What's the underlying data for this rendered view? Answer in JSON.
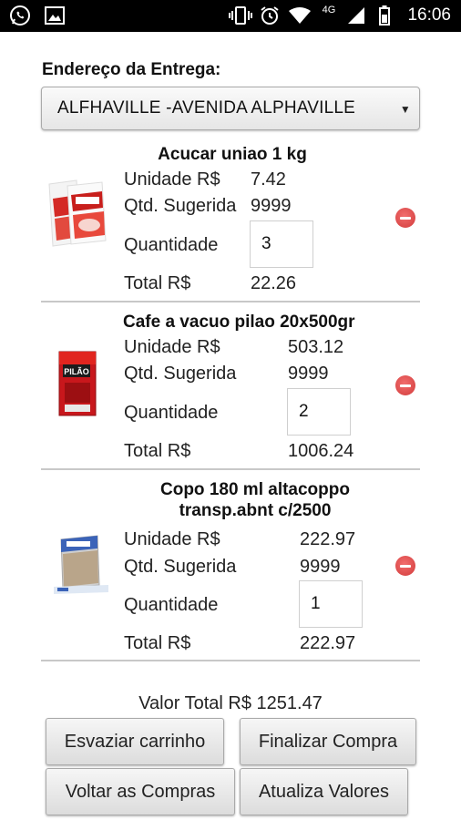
{
  "status_bar": {
    "time": "16:06",
    "network": "4G",
    "icons": [
      "whatsapp-icon",
      "image-icon",
      "vibrate-icon",
      "alarm-icon",
      "wifi-icon",
      "signal-icon",
      "battery-icon"
    ]
  },
  "address": {
    "label": "Endereço da Entrega:",
    "selected": "ALFHAVILLE -AVENIDA ALPHAVILLE"
  },
  "items": [
    {
      "name": "Acucar uniao 1 kg",
      "unit_label": "Unidade R$",
      "unit_value": "7.42",
      "suggested_label": "Qtd. Sugerida",
      "suggested_value": "9999",
      "qty_label": "Quantidade",
      "qty_value": "3",
      "total_label": "Total R$",
      "total_value": "22.26",
      "image": "sugar-package-icon"
    },
    {
      "name": "Cafe a vacuo pilao 20x500gr",
      "unit_label": "Unidade R$",
      "unit_value": "503.12",
      "suggested_label": "Qtd. Sugerida",
      "suggested_value": "9999",
      "qty_label": "Quantidade",
      "qty_value": "2",
      "total_label": "Total R$",
      "total_value": "1006.24",
      "image": "coffee-package-icon"
    },
    {
      "name_line1": "Copo 180 ml altacoppo",
      "name_line2": "transp.abnt c/2500",
      "unit_label": "Unidade R$",
      "unit_value": "222.97",
      "suggested_label": "Qtd. Sugerida",
      "suggested_value": "9999",
      "qty_label": "Quantidade",
      "qty_value": "1",
      "total_label": "Total R$",
      "total_value": "222.97",
      "image": "cups-box-icon"
    }
  ],
  "summary": {
    "total_text": "Valor Total R$ 1251.47"
  },
  "buttons": {
    "empty_cart": "Esvaziar carrinho",
    "checkout": "Finalizar Compra",
    "back": "Voltar as Compras",
    "update": "Atualiza Valores"
  },
  "colors": {
    "remove_icon": "#d23c3c",
    "status_bar": "#000000",
    "divider": "#c8c8c8"
  }
}
